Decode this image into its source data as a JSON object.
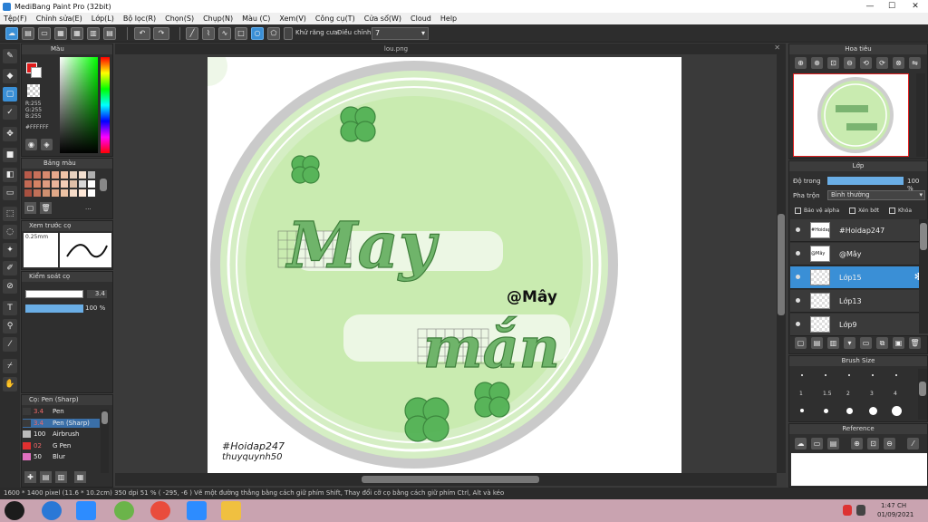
{
  "window": {
    "title": "MediBang Paint Pro (32bit)",
    "minimize": "—",
    "maximize": "☐",
    "close": "✕"
  },
  "menu": [
    "Tệp(F)",
    "Chỉnh sửa(E)",
    "Lớp(L)",
    "Bộ lọc(R)",
    "Chọn(S)",
    "Chụp(N)",
    "Màu (C)",
    "Xem(V)",
    "Công cụ(T)",
    "Cửa sổ(W)",
    "Cloud",
    "Help"
  ],
  "toolbar": {
    "antialias_label": "Khử răng cưa",
    "correction_label": "Điều chỉnh",
    "correction_value": "7"
  },
  "panels": {
    "color": {
      "title": "Màu",
      "r": "R:255",
      "g": "G:255",
      "b": "B:255",
      "hex": "#FFFFFF"
    },
    "palette": {
      "title": "Bảng màu",
      "more": "..."
    },
    "preview": {
      "title": "Xem trước cọ",
      "size": "0.25mm"
    },
    "brush_control": {
      "title": "Kiểm soát cọ",
      "size": "3.4",
      "opacity": "100 %"
    },
    "brush_list": {
      "title": "Cọ: Pen (Sharp)",
      "items": [
        {
          "num": "3.4",
          "name": "Pen",
          "color": "#3a3a3a"
        },
        {
          "num": "3.4",
          "name": "Pen (Sharp)",
          "color": "#3a3a3a"
        },
        {
          "num": "100",
          "name": "Airbrush",
          "color": "#bbbbbb"
        },
        {
          "num": "02",
          "name": "G Pen",
          "color": "#e03030"
        },
        {
          "num": "50",
          "name": "Blur",
          "color": "#e070c0"
        }
      ]
    },
    "navigator": {
      "title": "Hoa tiêu"
    },
    "layer": {
      "title": "Lớp",
      "opacity_label": "Độ trong",
      "opacity_value": "100 %",
      "blend_label": "Pha trộn",
      "blend_value": "Bình thường",
      "protect_alpha": "Bảo vệ alpha",
      "clip": "Xén bớt",
      "lock": "Khóa",
      "layers": [
        {
          "name": "#Hoidap247",
          "thumb": "#Hoidap",
          "selected": false
        },
        {
          "name": "@Mây",
          "thumb": "@Mây",
          "selected": false
        },
        {
          "name": "Lớp15",
          "thumb": "",
          "selected": true
        },
        {
          "name": "Lớp13",
          "thumb": "",
          "selected": false
        },
        {
          "name": "Lớp9",
          "thumb": "",
          "selected": false
        }
      ]
    },
    "brush_size": {
      "title": "Brush Size",
      "labels": [
        "1",
        "1.5",
        "2",
        "3",
        "4"
      ]
    },
    "reference": {
      "title": "Reference"
    }
  },
  "canvas": {
    "tab": "lou.png",
    "art_title_top": "May",
    "art_title_bottom": "mắn",
    "art_handle": "@Mây",
    "art_credit1": "#Hoidap247",
    "art_credit2": "thuyquynh50"
  },
  "status": {
    "text": "1600 * 1400 pixel   (11.6 * 10.2cm)   350 dpi   51 %   ( -295, -6 )   Vẽ một đường thẳng bằng cách giữ phím Shift, Thay đổi cỡ cọ bằng cách giữ phím Ctrl, Alt và kéo"
  },
  "taskbar": {
    "time": "1:47 CH",
    "date": "01/09/2021"
  },
  "colors": {
    "accent": "#3a8fd6",
    "panel": "#2f2f2f",
    "canvas_green": "#c9ebb0"
  }
}
